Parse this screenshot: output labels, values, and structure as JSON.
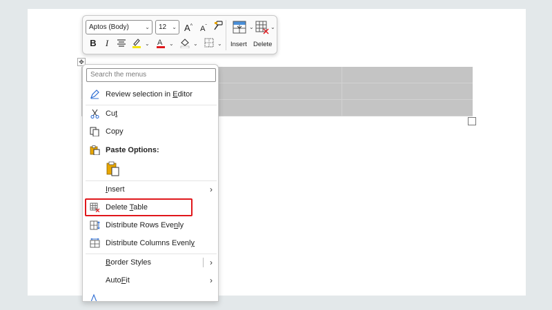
{
  "toolbar": {
    "font_name": "Aptos (Body)",
    "font_size": "12",
    "bold": "B",
    "italic": "I",
    "insert_label": "Insert",
    "delete_label": "Delete",
    "highlight_color": "#f5e400",
    "font_color": "#e0161b"
  },
  "menu": {
    "search_placeholder": "Search the menus",
    "review_pre": "Review selection in ",
    "review_mn": "E",
    "review_post": "ditor",
    "cut_pre": "Cu",
    "cut_mn": "t",
    "copy": "Copy",
    "paste_options": "Paste Options:",
    "insert_mn": "I",
    "insert_post": "nsert",
    "delete_pre": "Delete ",
    "delete_mn": "T",
    "delete_post": "able",
    "dist_rows_pre": "Distribute Rows Eve",
    "dist_rows_mn": "n",
    "dist_rows_post": "ly",
    "dist_cols_pre": "Distribute Columns Evenl",
    "dist_cols_mn": "y",
    "border_pre": "",
    "border_mn": "B",
    "border_post": "order Styles",
    "autofit_pre": "Auto",
    "autofit_mn": "F",
    "autofit_post": "it",
    "highlight_color": "#e0161b"
  }
}
